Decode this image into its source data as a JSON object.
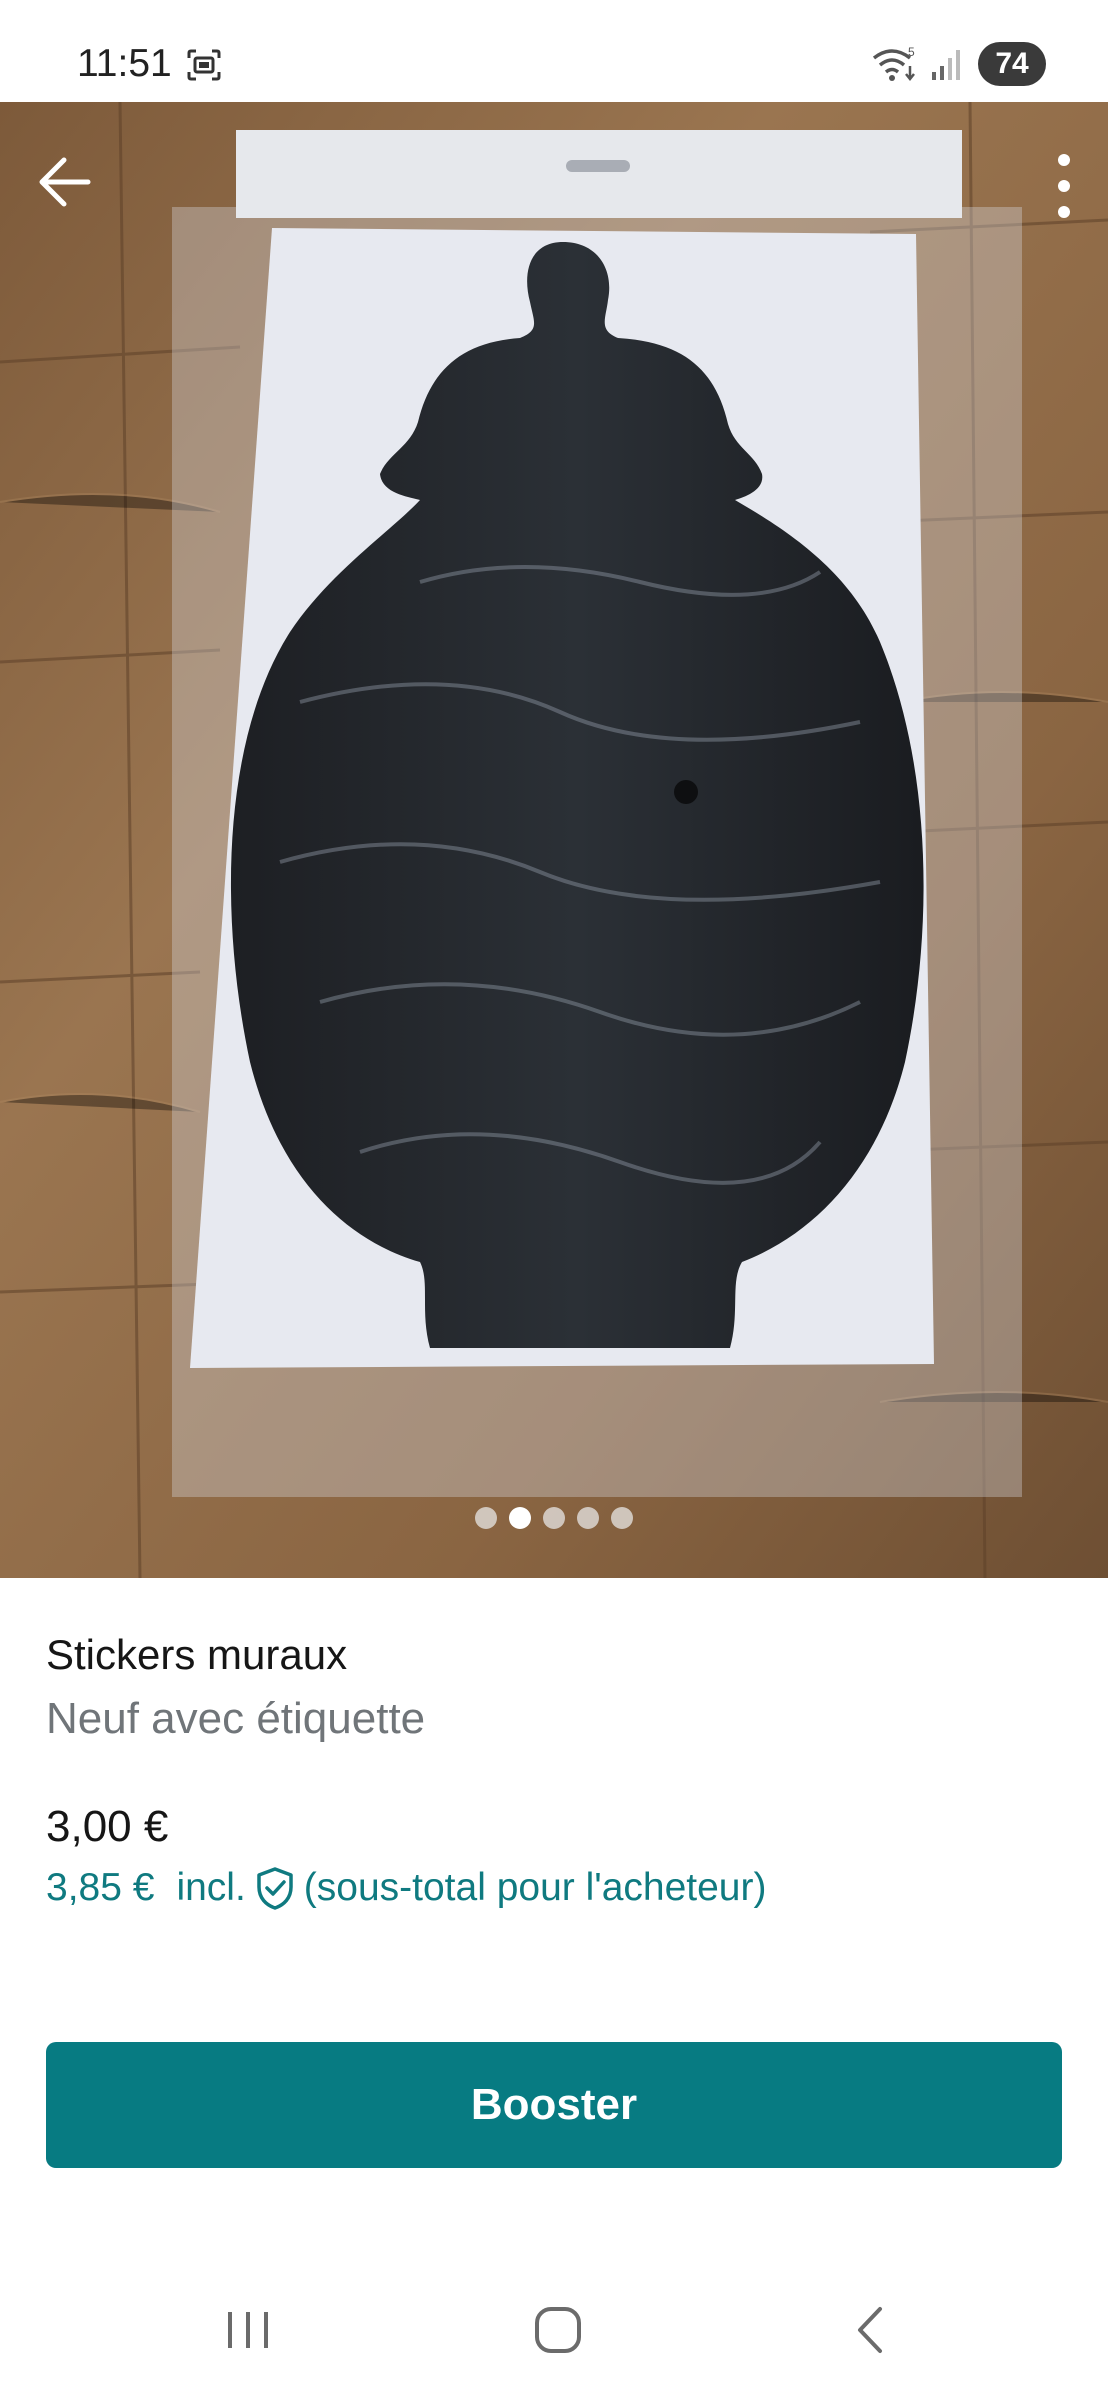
{
  "status_bar": {
    "time": "11:51",
    "battery": "74",
    "icons": [
      "screen-record-icon",
      "wifi-icon",
      "signal-icon"
    ]
  },
  "toolbar": {
    "back_icon": "arrow-left-icon",
    "more_icon": "more-vertical-icon"
  },
  "gallery": {
    "total_images": 5,
    "active_index": 1
  },
  "item": {
    "title": "Stickers muraux",
    "condition": "Neuf avec étiquette",
    "price": "3,00 €",
    "price_with_protection": "3,85 €",
    "incl_label": "incl.",
    "buyer_subtotal_label": "(sous-total pour l'acheteur)"
  },
  "actions": {
    "booster_label": "Booster"
  },
  "nav_bar": {
    "icons": [
      "recent-apps-icon",
      "home-icon",
      "back-icon"
    ]
  },
  "colors": {
    "accent": "#077b82",
    "accent_text": "#0f7a80",
    "secondary_text": "#707579"
  }
}
